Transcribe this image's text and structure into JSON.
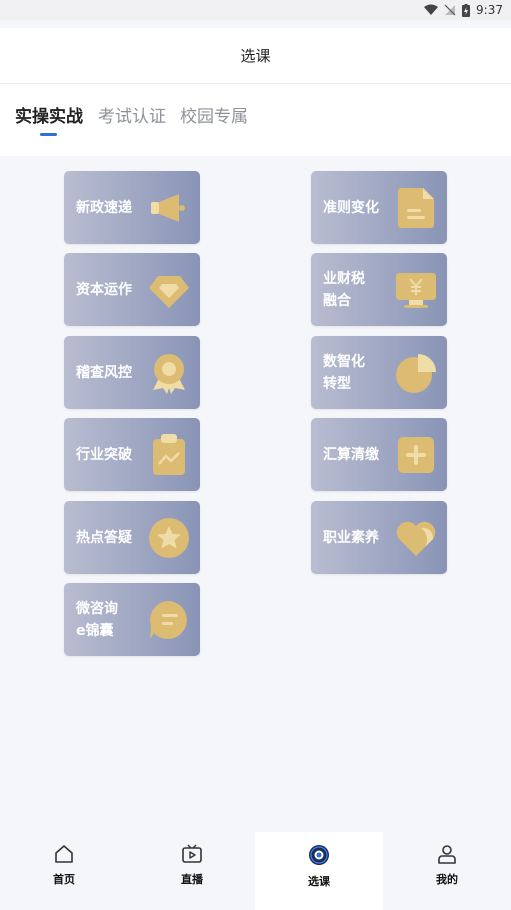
{
  "status_bar": {
    "time": "9:37"
  },
  "header": {
    "title": "选课"
  },
  "tabs": [
    {
      "label": "实操实战",
      "active": true
    },
    {
      "label": "考试认证",
      "active": false
    },
    {
      "label": "校园专属",
      "active": false
    }
  ],
  "courses_left": [
    {
      "label": "新政速递",
      "icon": "megaphone-icon"
    },
    {
      "label": "资本运作",
      "icon": "diamond-icon"
    },
    {
      "label": "稽查风控",
      "icon": "award-ribbon-icon"
    },
    {
      "label": "行业突破",
      "icon": "clipboard-chart-icon"
    },
    {
      "label": "热点答疑",
      "icon": "star-circle-icon"
    },
    {
      "label": "微咨询\ne锦囊",
      "icon": "chat-bubble-icon"
    }
  ],
  "courses_right": [
    {
      "label": "准则变化",
      "icon": "document-icon"
    },
    {
      "label": "业财税\n融合",
      "icon": "monitor-yen-icon"
    },
    {
      "label": "数智化\n转型",
      "icon": "pie-chart-icon"
    },
    {
      "label": "汇算清缴",
      "icon": "plus-box-icon"
    },
    {
      "label": "职业素养",
      "icon": "heart-icon"
    }
  ],
  "bottom_nav": [
    {
      "label": "首页",
      "icon": "home-icon"
    },
    {
      "label": "直播",
      "icon": "tv-play-icon"
    },
    {
      "label": "选课",
      "icon": "course-select-icon",
      "active": true
    },
    {
      "label": "我的",
      "icon": "user-icon"
    }
  ],
  "colors": {
    "accent": "#2f6fd6",
    "card_start": "#b9bdd1",
    "card_end": "#8994b6",
    "icon_gold": "#dcbb72"
  }
}
